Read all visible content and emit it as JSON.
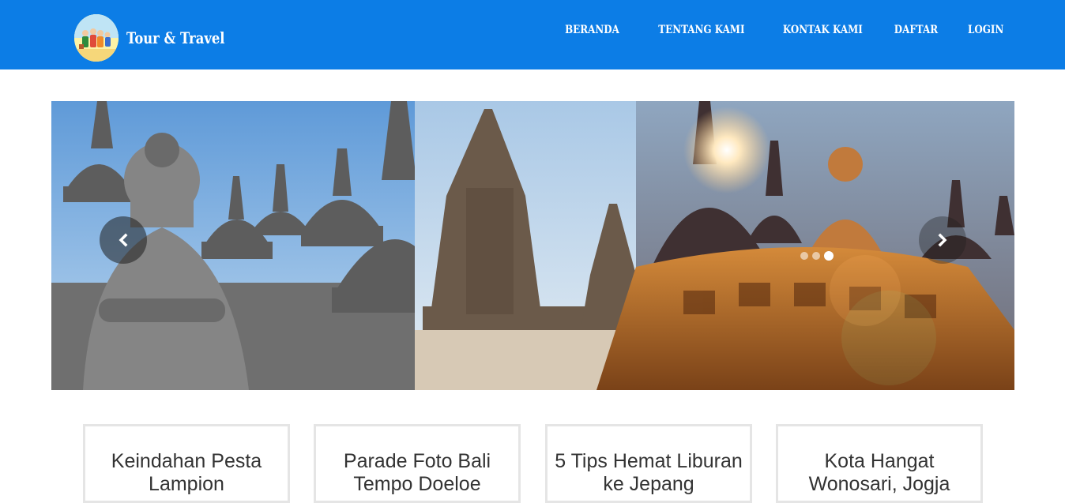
{
  "header": {
    "brand_title": "Tour & Travel",
    "logo_icon": "family-travel-logo",
    "background_color": "#0c7de6",
    "nav_items": [
      {
        "label": "BERANDA"
      },
      {
        "label": "TENTANG KAMI"
      },
      {
        "label": "KONTAK KAMI"
      },
      {
        "label": "DAFTAR"
      },
      {
        "label": "LOGIN"
      }
    ]
  },
  "carousel": {
    "prev_icon": "chevron-left-icon",
    "next_icon": "chevron-right-icon",
    "slide_count": 3,
    "active_slide": 3,
    "image_description_icon": "temple-banner-image"
  },
  "cards": [
    {
      "title": "Keindahan Pesta Lampion"
    },
    {
      "title": "Parade Foto Bali Tempo Doeloe"
    },
    {
      "title": "5 Tips Hemat Liburan ke Jepang"
    },
    {
      "title": "Kota Hangat Wonosari, Jogja"
    }
  ]
}
